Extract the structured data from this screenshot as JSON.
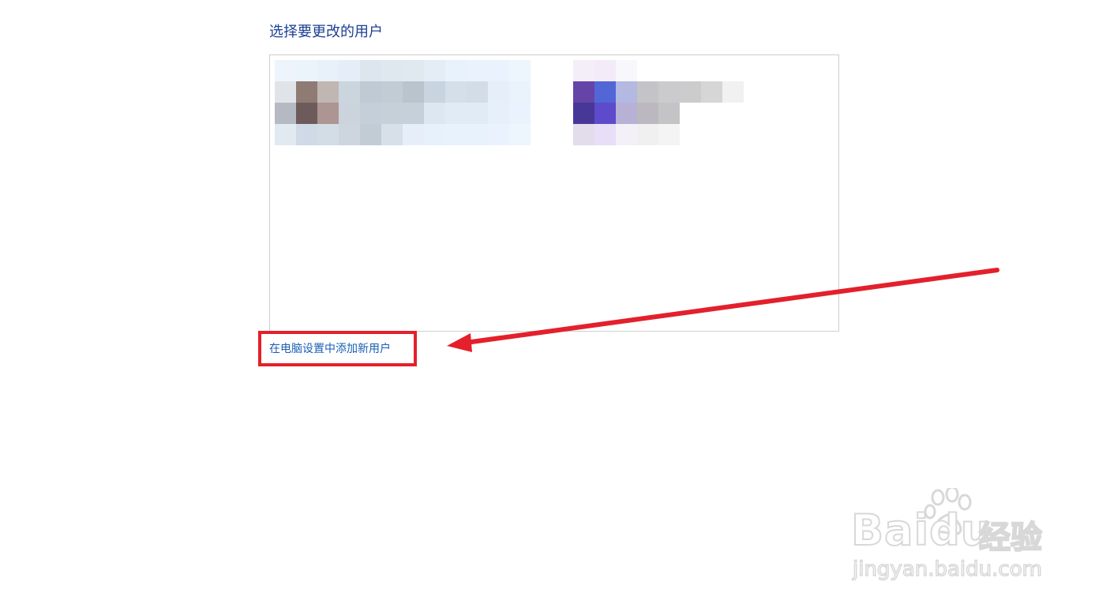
{
  "page": {
    "title": "选择要更改的用户",
    "add_user_link": "在电脑设置中添加新用户"
  },
  "users": [
    {
      "name": "",
      "pixels": [
        [
          "#eef4fb",
          "#ebf3fb",
          "#e8f1fa",
          "#e5eef8",
          "#dde6ef",
          "#dfe7ef",
          "#e0e8f0",
          "#e4edf6",
          "#e8f2fc",
          "#eaf3fd",
          "#eaf3fd",
          "#edf5fd"
        ],
        [
          "#e0e4e8",
          "#907a74",
          "#c0b6b2",
          "#cad5de",
          "#bfcad5",
          "#c2ccd5",
          "#b9c4cc",
          "#c8d4df",
          "#d4dfe9",
          "#d2dde8",
          "#e6eff9",
          "#eaf3fc"
        ],
        [
          "#b5b9c1",
          "#6d5b5b",
          "#ac9593",
          "#cbd4dd",
          "#c4cfda",
          "#c6d0d9",
          "#c6d0da",
          "#dce7f2",
          "#e1ebf6",
          "#e1ebf6",
          "#e6f0fb",
          "#eaf3fd"
        ],
        [
          "#e1e9f1",
          "#d0dae6",
          "#d3dde6",
          "#cdd6de",
          "#c2ccd5",
          "#d7e0e8",
          "#e6eff9",
          "#e7f1fb",
          "#e8f2fc",
          "#e8f2fc",
          "#eaf3fd",
          "#edf5fd"
        ]
      ]
    },
    {
      "name": "",
      "pixels": [
        [
          "#f4eef8",
          "#f3ecf8",
          "#f8f7fb",
          "#ffffff",
          "#ffffff",
          "#ffffff",
          "#ffffff",
          "#ffffff",
          "#ffffff",
          "#ffffff",
          "#ffffff",
          "#ffffff"
        ],
        [
          "#6544a8",
          "#5266d6",
          "#b3b9e0",
          "#c4c4c8",
          "#cbcbcd",
          "#cccccc",
          "#d6d6d6",
          "#f1f1f1",
          "#ffffff",
          "#ffffff",
          "#ffffff",
          "#ffffff"
        ],
        [
          "#473897",
          "#5d4bcc",
          "#b7b1d6",
          "#bbb8bf",
          "#c4c4c6",
          "#ffffff",
          "#ffffff",
          "#ffffff",
          "#ffffff",
          "#ffffff",
          "#ffffff",
          "#ffffff"
        ],
        [
          "#e3dcea",
          "#e8def7",
          "#f3f0f7",
          "#f0f0f1",
          "#f4f4f4",
          "#ffffff",
          "#ffffff",
          "#ffffff",
          "#ffffff",
          "#ffffff",
          "#ffffff",
          "#ffffff"
        ]
      ]
    }
  ],
  "watermark": {
    "brand": "Baidu",
    "cn": "经验",
    "url": "jingyan.baidu.com"
  },
  "icons": {
    "watermark_logo": "paw-icon",
    "annotation": "arrow-icon"
  },
  "colors": {
    "title": "#1c3f94",
    "link": "#1a5fb4",
    "annotation": "#e3202b",
    "border": "#cfcfcf"
  }
}
